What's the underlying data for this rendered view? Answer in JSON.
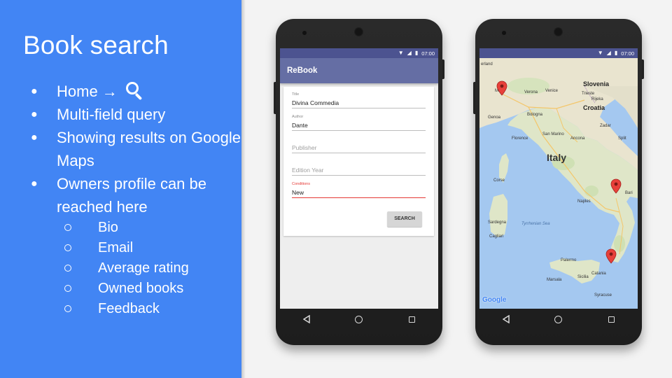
{
  "slide": {
    "title": "Book search",
    "bullets": [
      {
        "text": "Home →",
        "icon": "search-icon"
      },
      {
        "text": "Multi-field query"
      },
      {
        "text": "Showing results on Google Maps"
      },
      {
        "text": "Owners profile can be reached here"
      }
    ],
    "sub_bullets": [
      "Bio",
      "Email",
      "Average rating",
      "Owned books",
      "Feedback"
    ]
  },
  "phone_left": {
    "status_time": "07:00",
    "app_title": "ReBook",
    "form": {
      "title_label": "Title",
      "title_value": "Divina Commedia",
      "author_label": "Author",
      "author_value": "Dante",
      "publisher_placeholder": "Publisher",
      "edition_year_placeholder": "Edition Year",
      "conditions_label": "Conditions",
      "conditions_value": "New",
      "search_button": "SEARCH"
    }
  },
  "phone_right": {
    "status_time": "07:00",
    "map": {
      "country": "Italy",
      "cities": [
        "Milan",
        "Verona",
        "Venice",
        "Genoa",
        "Bologna",
        "Florence",
        "San Marino",
        "Naples",
        "Bari",
        "Palermo",
        "Catania",
        "Marsala",
        "Syracuse",
        "Zadar",
        "Split",
        "Trieste",
        "Cagliari",
        "Corse",
        "Sardegna",
        "Sicilia",
        "Croatia",
        "Slovenia",
        "Rijeka",
        "Ancona"
      ],
      "sea": "Tyrrhenian Sea",
      "partial_label": "erland",
      "branding": "Google",
      "markers": [
        "Milan",
        "Bari",
        "Calabria"
      ]
    }
  },
  "colors": {
    "panel_blue": "#4285f4",
    "status_bar": "#4c5390",
    "app_bar": "#656ea4",
    "accent_red": "#e53935"
  }
}
